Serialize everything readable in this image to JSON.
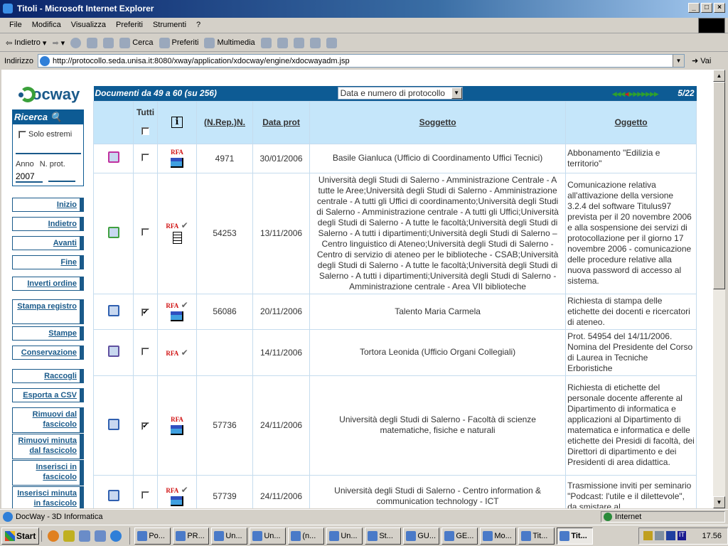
{
  "window": {
    "title": "Titoli - Microsoft Internet Explorer"
  },
  "menu": [
    "File",
    "Modifica",
    "Visualizza",
    "Preferiti",
    "Strumenti",
    "?"
  ],
  "toolbar": {
    "back": "Indietro",
    "search": "Cerca",
    "favorites": "Preferiti",
    "media": "Multimedia"
  },
  "address": {
    "label": "Indirizzo",
    "url": "http://protocollo.seda.unisa.it:8080/xway/application/xdocway/engine/xdocwayadm.jsp",
    "go": "Vai"
  },
  "logo": "docway",
  "ricerca": {
    "title": "Ricerca",
    "solo_estremi": "Solo estremi",
    "anno_label": "Anno",
    "nprot_label": "N. prot.",
    "anno_value": "2007",
    "nprot_value": ""
  },
  "nav": [
    "Inizio",
    "Indietro",
    "Avanti",
    "Fine",
    "Inverti ordine",
    "Stampa registro",
    "Stampe",
    "Conservazione",
    "Raccogli",
    "Esporta a CSV",
    "Rimuovi dal fascicolo",
    "Rimuovi minuta dal fascicolo",
    "Inserisci in fascicolo",
    "Inserisci minuta in fascicolo"
  ],
  "results": {
    "title": "Documenti da 49 a 60",
    "total": "(su 256)",
    "sort": "Data e numero di protocollo",
    "page": "5/22",
    "current_page": 5,
    "total_pages": 22
  },
  "columns": {
    "tutti": "Tutti",
    "info": "i",
    "num": "(N.Rep.)N.",
    "data": "Data prot",
    "soggetto": "Soggetto",
    "oggetto": "Oggetto"
  },
  "rows": [
    {
      "num": "4971",
      "data": "30/01/2006",
      "soggetto": "Basile Gianluca (Ufficio di Coordinamento Uffici Tecnici)",
      "oggetto": "Abbonamento \"Edilizia e territorio\"",
      "checked": false,
      "rfa": "RFA",
      "rfa_check": false,
      "icon_color": "#c030a0"
    },
    {
      "num": "54253",
      "data": "13/11/2006",
      "soggetto": "Università degli Studi di Salerno - Amministrazione Centrale - A tutte le Aree;Università degli Studi di Salerno - Amministrazione centrale - A tutti gli Uffici di coordinamento;Università degli Studi di Salerno - Amministrazione centrale - A tutti gli Uffici;Università degli Studi di Salerno - A tutte le facoltà;Università degli Studi di Salerno - A tutti i dipartimenti;Università degli Studi di Salerno – Centro linguistico di Ateneo;Università degli Studi di Salerno - Centro di servizio di ateneo per le biblioteche - CSAB;Università degli Studi di Salerno - A tutte le facoltà;Università degli Studi di Salerno - A tutti i dipartimenti;Università degli Studi di Salerno - Amministrazione centrale - Area VII biblioteche",
      "oggetto": "Comunicazione relativa all'attivazione della versione 3.2.4 del software Titulus97 prevista per il 20 novembre 2006 e alla sospensione dei servizi di protocollazione per il giorno 17 novembre 2006 - comunicazione delle procedure relative alla nuova password di accesso al sistema.",
      "checked": false,
      "rfa": "RFA",
      "rfa_check": true,
      "icon_color": "#40a040"
    },
    {
      "num": "56086",
      "data": "20/11/2006",
      "soggetto": "Talento Maria Carmela",
      "oggetto": "Richiesta di stampa delle etichette dei docenti e ricercatori di ateneo.",
      "checked": true,
      "rfa": "RFA",
      "rfa_check": true,
      "icon_color": "#3060b0"
    },
    {
      "num": "",
      "data": "14/11/2006",
      "soggetto": "Tortora Leonida (Ufficio Organi Collegiali)",
      "oggetto": "Prot. 54954 del 14/11/2006. Nomina del Presidente del Corso di Laurea in Tecniche Erboristiche",
      "checked": false,
      "rfa": "RFA",
      "rfa_check": true,
      "icon_color": "#6050a0"
    },
    {
      "num": "57736",
      "data": "24/11/2006",
      "soggetto": "Università degli Studi di Salerno - Facoltà di scienze matematiche, fisiche e naturali",
      "oggetto": "Richiesta di etichette del personale docente afferente al Dipartimento di informatica e applicazioni al Dipartimento di matematica e informatica e delle etichette dei Presidi di facoltà, dei Direttori di dipartimento e dei Presidenti di area didattica.",
      "checked": true,
      "rfa": "RFA",
      "rfa_check": false,
      "icon_color": "#3060b0"
    },
    {
      "num": "57739",
      "data": "24/11/2006",
      "soggetto": "Università degli Studi di Salerno - Centro information & communication technology - ICT",
      "oggetto": "Trasmissione inviti per seminario \"Podcast: l'utile e il dilettevole\", da smistare al",
      "checked": false,
      "rfa": "RFA",
      "rfa_check": true,
      "icon_color": "#3060b0"
    }
  ],
  "status": {
    "text": "DocWay - 3D Informatica",
    "zone": "Internet"
  },
  "taskbar": {
    "start": "Start",
    "tasks": [
      "Po...",
      "PR...",
      "Un...",
      "Un...",
      "(n...",
      "Un...",
      "St...",
      "GU...",
      "GE...",
      "Mo...",
      "Tit...",
      "Tit..."
    ],
    "lang": "IT",
    "clock": "17.56"
  },
  "colors": {
    "header_blue": "#0d5b94",
    "header_light": "#c5e6fa",
    "link": "#1a5a8a",
    "rfa": "#d01010"
  }
}
